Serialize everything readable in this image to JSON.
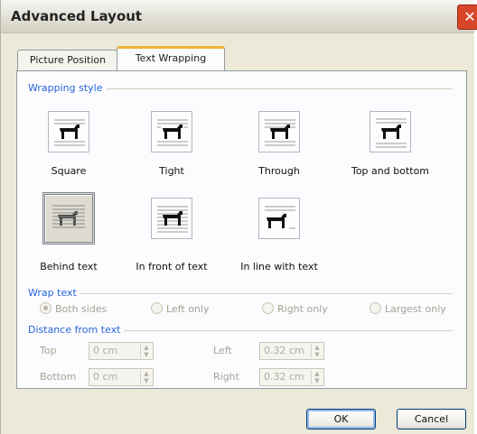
{
  "window": {
    "title": "Advanced Layout",
    "close_glyph": "✕"
  },
  "tabs": [
    {
      "label": "Picture Position",
      "active": false
    },
    {
      "label": "Text Wrapping",
      "active": true
    }
  ],
  "wrapping_style": {
    "label": "Wrapping style",
    "options": [
      {
        "label": "Square",
        "icon": "wrap-square-icon"
      },
      {
        "label": "Tight",
        "icon": "wrap-tight-icon"
      },
      {
        "label": "Through",
        "icon": "wrap-through-icon"
      },
      {
        "label": "Top and bottom",
        "icon": "wrap-top-bottom-icon"
      },
      {
        "label": "Behind text",
        "icon": "wrap-behind-text-icon",
        "selected": true
      },
      {
        "label": "In front of text",
        "icon": "wrap-in-front-icon"
      },
      {
        "label": "In line with text",
        "icon": "wrap-inline-icon"
      }
    ]
  },
  "wrap_text": {
    "label": "Wrap text",
    "options": [
      {
        "label": "Both sides",
        "selected": true
      },
      {
        "label": "Left only"
      },
      {
        "label": "Right only"
      },
      {
        "label": "Largest only"
      }
    ]
  },
  "distance": {
    "label": "Distance from text",
    "top": {
      "label": "Top",
      "value": "0 cm"
    },
    "bottom": {
      "label": "Bottom",
      "value": "0 cm"
    },
    "left": {
      "label": "Left",
      "value": "0.32 cm"
    },
    "right": {
      "label": "Right",
      "value": "0.32 cm"
    }
  },
  "buttons": {
    "ok": "OK",
    "cancel": "Cancel"
  },
  "colors": {
    "group_label": "#2864d8",
    "disabled_text": "#a3a295",
    "dialog_bg": "#ece9d8",
    "tab_accent": "#f0b232"
  }
}
